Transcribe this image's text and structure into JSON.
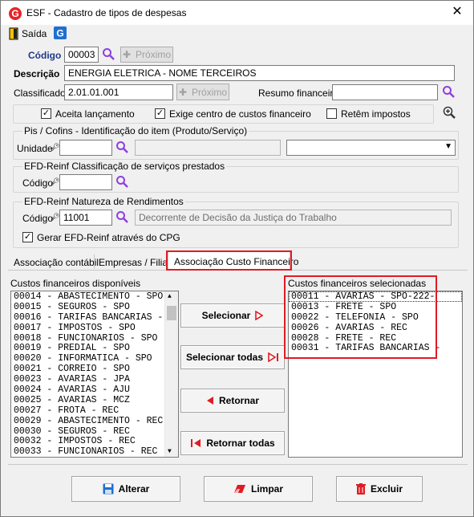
{
  "window": {
    "title": "ESF - Cadastro de tipos de despesas",
    "close_label": "✕"
  },
  "toolbar": {
    "exit_label": "Saída"
  },
  "form": {
    "codigo_label": "Código",
    "codigo_value": "00003",
    "proximo_label": "Próximo",
    "descricao_label": "Descrição",
    "descricao_value": "ENERGIA ELETRICA - NOME TERCEIROS",
    "classificador_label": "Classificador",
    "classificador_value": "2.01.01.001",
    "resumo_label": "Resumo financeiro",
    "resumo_value": "",
    "aceita_label": "Aceita lançamento",
    "aceita_checked": true,
    "exige_label": "Exige centro de custos financeiro",
    "exige_checked": true,
    "retem_label": "Retêm impostos",
    "retem_checked": false
  },
  "pis_group": {
    "caption": "Pis / Cofins - Identificação do item (Produto/Serviço)",
    "unidade_label": "Unidade",
    "unidade_value": "",
    "desc_value": "",
    "select_value": ""
  },
  "efd_class": {
    "caption": "EFD-Reinf Classificação de serviços prestados",
    "codigo_label": "Código",
    "codigo_value": ""
  },
  "efd_nat": {
    "caption": "EFD-Reinf Natureza de Rendimentos",
    "codigo_label": "Código",
    "codigo_value": "11001",
    "desc_value": "Decorrente de Decisão da Justiça do Trabalho",
    "gerar_label": "Gerar EFD-Reinf através do CPG",
    "gerar_checked": true
  },
  "tabs": [
    {
      "label": "Associação contábil"
    },
    {
      "label": "Empresas / Filiais"
    },
    {
      "label": "Associação Custo Financeiro"
    }
  ],
  "assoc": {
    "available_caption": "Custos financeiros disponíveis",
    "available_items": [
      "00014 - ABASTECIMENTO - SPO",
      "00015 - SEGUROS - SPO",
      "00016 - TARIFAS BANCARIAS -",
      "00017 - IMPOSTOS - SPO",
      "00018 - FUNCIONARIOS - SPO",
      "00019 - PREDIAL - SPO",
      "00020 - INFORMATICA - SPO",
      "00021 - CORREIO - SPO",
      "00023 - AVARIAS - JPA",
      "00024 - AVARIAS - AJU",
      "00025 - AVARIAS - MCZ",
      "00027 - FROTA - REC",
      "00029 - ABASTECIMENTO - REC",
      "00030 - SEGUROS - REC",
      "00032 - IMPOSTOS - REC",
      "00033 - FUNCIONARIOS - REC"
    ],
    "selected_caption": "Custos financeiros selecionadas",
    "selected_items": [
      "00011 - AVARIAS - SPO-222-",
      "00013 - FRETE - SPO",
      "00022 - TELEFONIA - SPO",
      "00026 - AVARIAS - REC",
      "00028 - FRETE - REC",
      "00031 - TARIFAS BANCARIAS -"
    ],
    "btn_selecionar": "Selecionar",
    "btn_selecionar_todas": "Selecionar todas",
    "btn_retornar": "Retornar",
    "btn_retornar_todas": "Retornar todas"
  },
  "footer": {
    "alterar": "Alterar",
    "limpar": "Limpar",
    "excluir": "Excluir"
  },
  "colors": {
    "brand": "#e3262a",
    "accent": "#1f6fd1",
    "highlight": "#e01b24"
  }
}
